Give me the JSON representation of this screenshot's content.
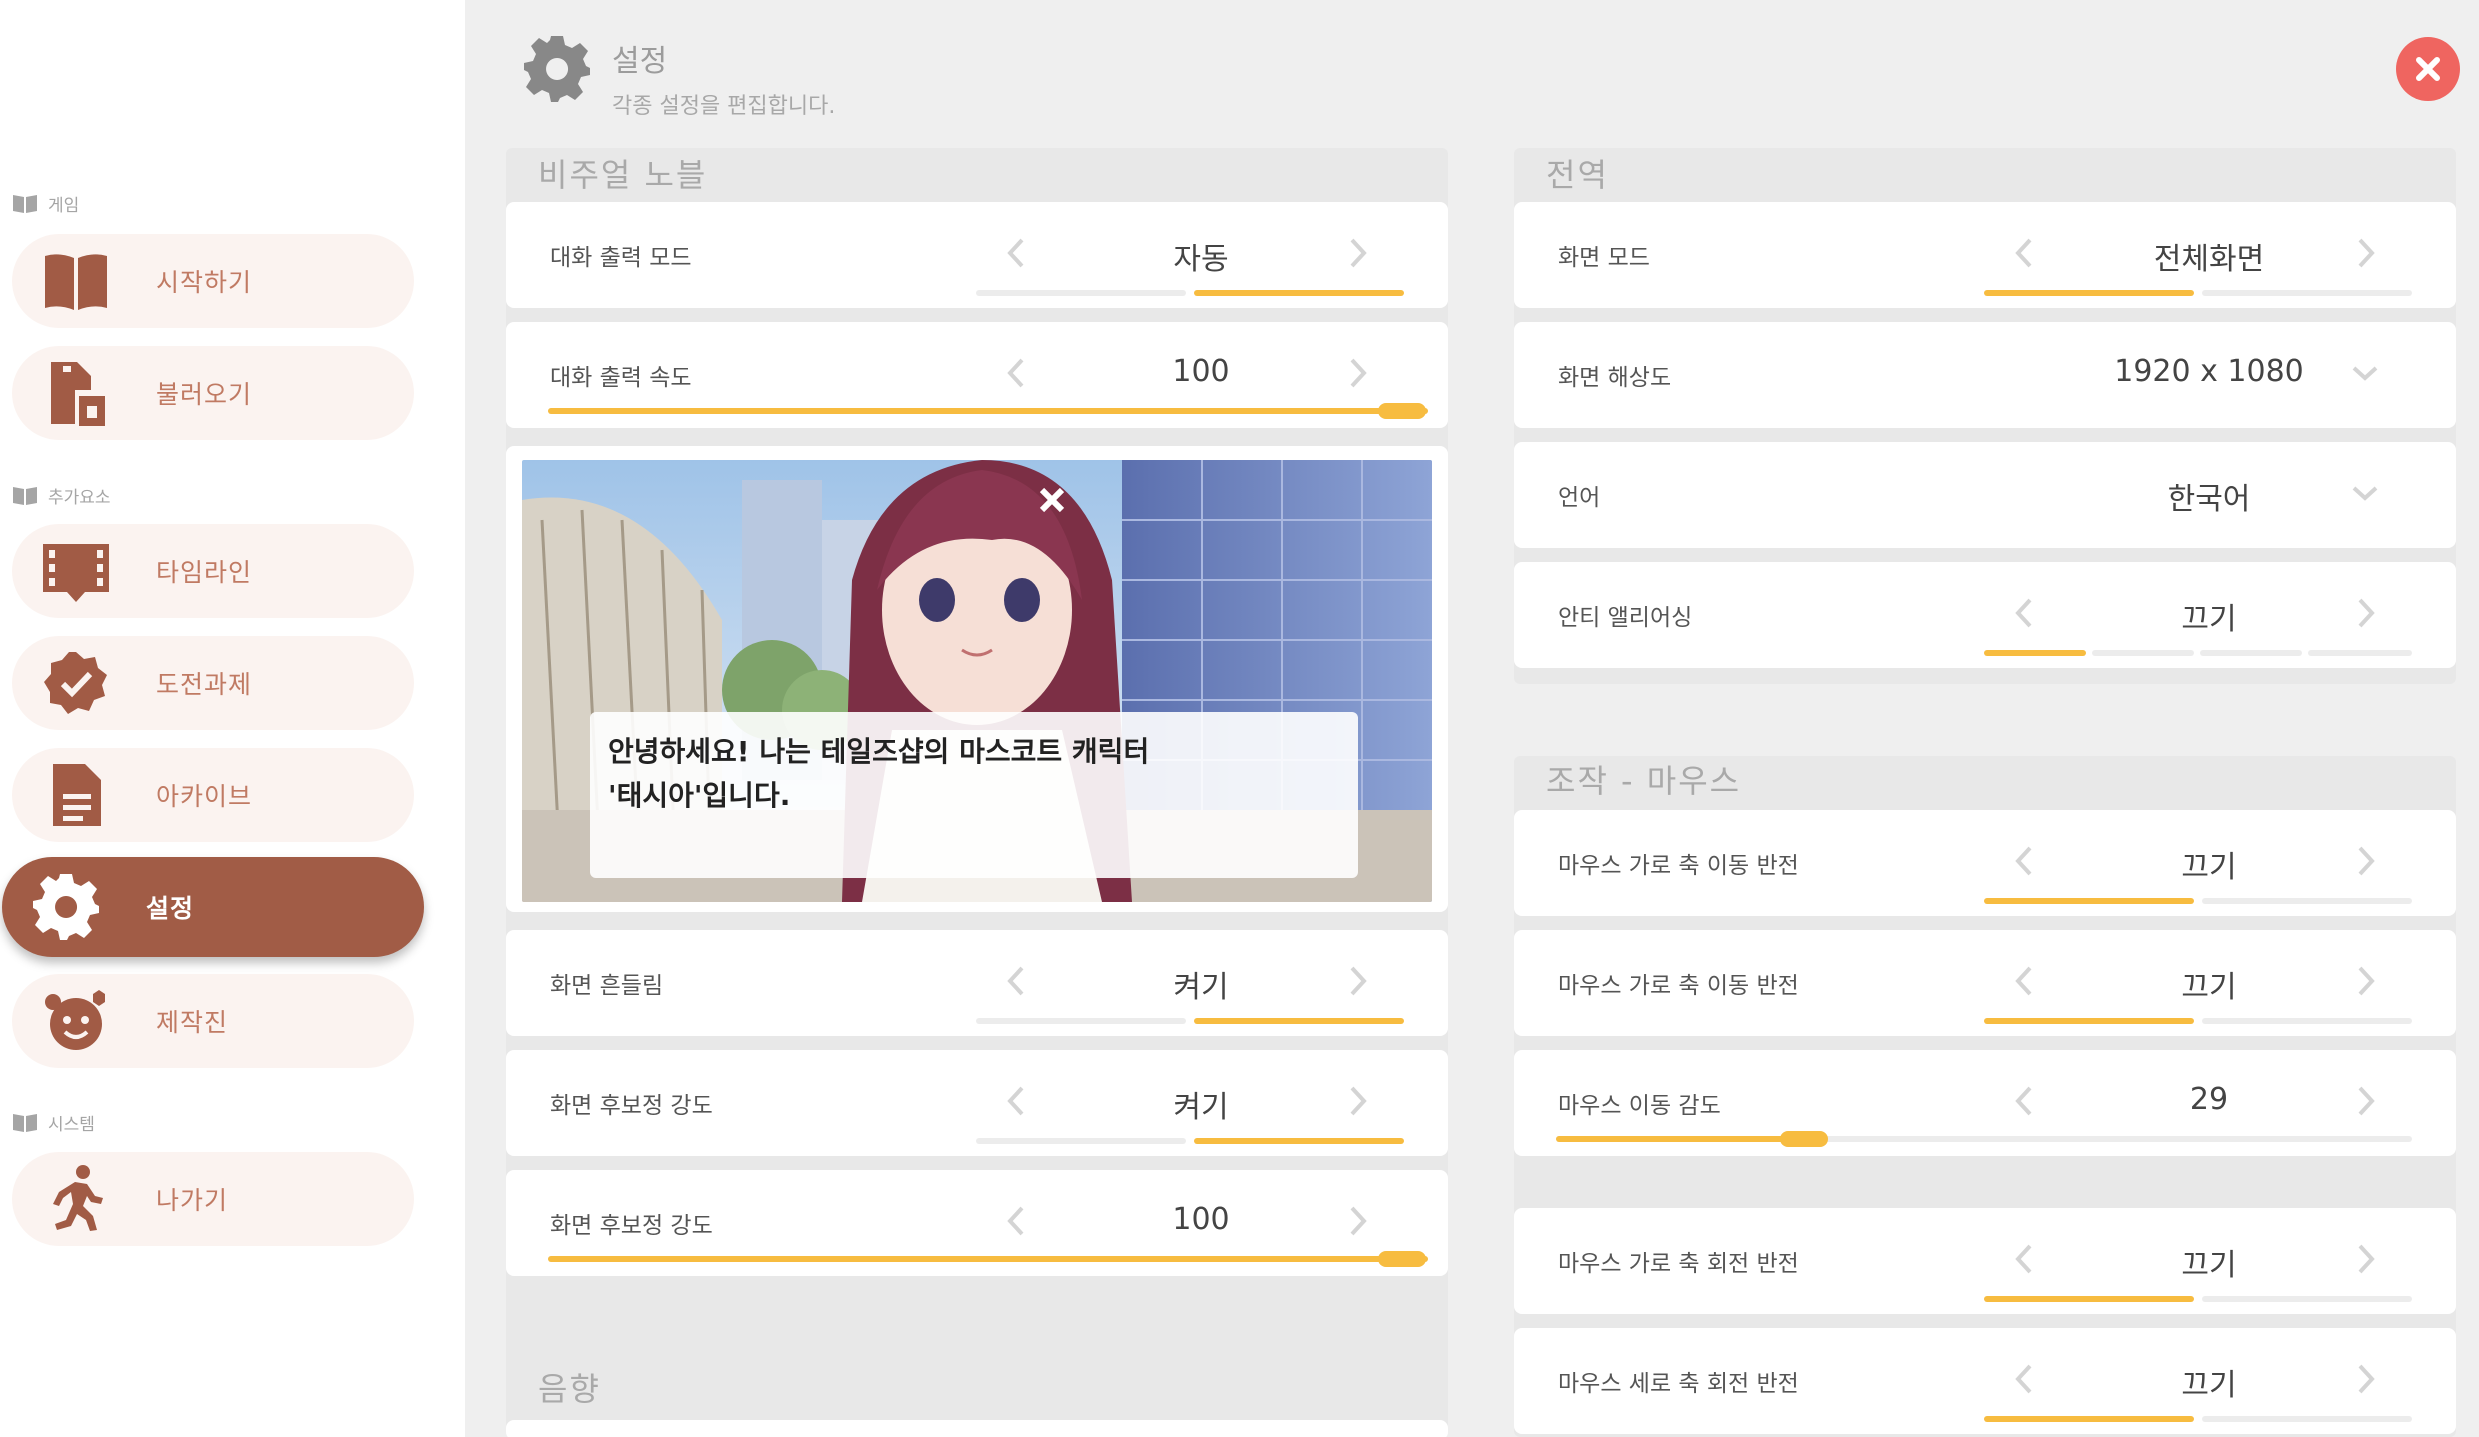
{
  "sidebar": {
    "sections": [
      {
        "label": "게임"
      },
      {
        "label": "추가요소"
      },
      {
        "label": "시스템"
      }
    ],
    "items": [
      {
        "label": "시작하기",
        "icon": "book-icon"
      },
      {
        "label": "불러오기",
        "icon": "load-file-icon"
      },
      {
        "label": "타임라인",
        "icon": "film-strip-icon"
      },
      {
        "label": "도전과제",
        "icon": "badge-check-icon"
      },
      {
        "label": "아카이브",
        "icon": "document-icon"
      },
      {
        "label": "설정",
        "icon": "gear-icon",
        "active": true
      },
      {
        "label": "제작진",
        "icon": "credits-icon"
      },
      {
        "label": "나가기",
        "icon": "running-person-icon"
      }
    ]
  },
  "header": {
    "title": "설정",
    "subtitle": "각종 설정을 편집합니다."
  },
  "visual_novel": {
    "title": "비주얼 노블",
    "dialog_mode": {
      "label": "대화 출력 모드",
      "value": "자동",
      "selected_index": 1,
      "options_count": 2
    },
    "dialog_speed": {
      "label": "대화 출력 속도",
      "value": "100",
      "level": 1.0
    },
    "preview_text_line1": "안녕하세요! 나는 테일즈샵의 마스코트 캐릭터",
    "preview_text_line2": "'태시아'입니다.",
    "screen_shake": {
      "label": "화면 흔들림",
      "value": "켜기",
      "selected_index": 1,
      "options_count": 2
    },
    "post_fx": {
      "label": "화면 후보정 강도",
      "value": "켜기",
      "selected_index": 1,
      "options_count": 2
    },
    "post_fx_strength": {
      "label": "화면 후보정 강도",
      "value": "100",
      "level": 1.0
    }
  },
  "audio": {
    "title": "음향"
  },
  "global": {
    "title": "전역",
    "screen_mode": {
      "label": "화면 모드",
      "value": "전체화면",
      "selected_index": 0,
      "options_count": 2
    },
    "resolution": {
      "label": "화면 해상도",
      "value": "1920 x 1080"
    },
    "language": {
      "label": "언어",
      "value": "한국어"
    },
    "anti_aliasing": {
      "label": "안티 앨리어싱",
      "value": "끄기",
      "selected_index": 0,
      "options_count": 4
    }
  },
  "mouse": {
    "title": "조작 - 마우스",
    "invert_x_move": {
      "label": "마우스 가로 축 이동 반전",
      "value": "끄기",
      "selected_index": 0,
      "options_count": 2
    },
    "invert_x_move_2": {
      "label": "마우스 가로 축 이동 반전",
      "value": "끄기",
      "selected_index": 0,
      "options_count": 2
    },
    "sensitivity": {
      "label": "마우스 이동 감도",
      "value": "29",
      "level": 0.29
    },
    "invert_x_rotate": {
      "label": "마우스 가로 축 회전 반전",
      "value": "끄기",
      "selected_index": 0,
      "options_count": 2
    },
    "invert_y_rotate": {
      "label": "마우스 세로 축 회전 반전",
      "value": "끄기",
      "selected_index": 0,
      "options_count": 2
    }
  },
  "colors": {
    "accent": "#f7bc40",
    "brand": "#a15c46",
    "close": "#ef6560"
  }
}
